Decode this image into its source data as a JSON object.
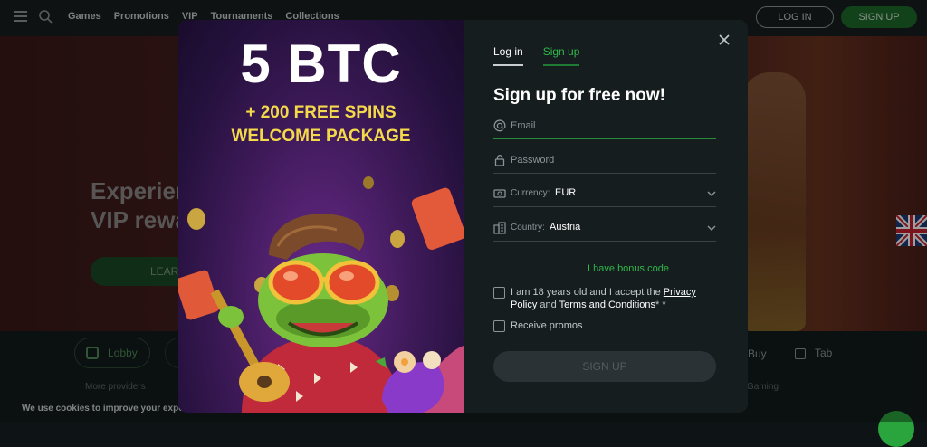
{
  "nav": {
    "links": [
      "Games",
      "Promotions",
      "VIP",
      "Tournaments",
      "Collections"
    ],
    "login_label": "LOG IN",
    "signup_label": "SIGN UP"
  },
  "hero": {
    "title_line1": "Experien",
    "title_line2": "VIP rewa",
    "learn_label": "LEAR"
  },
  "lower": {
    "lobby_label": "Lobby",
    "more_providers": "More providers",
    "buy_label": "Buy",
    "table_label": "Tab",
    "gaming_label": "Gaming",
    "cookie_text": "We use cookies to improve your expe"
  },
  "promo": {
    "headline": "5 BTC",
    "subline1": "+ 200 FREE SPINS",
    "subline2": "WELCOME PACKAGE"
  },
  "form": {
    "tabs": [
      {
        "label": "Log in",
        "active": false
      },
      {
        "label": "Sign up",
        "active": true
      }
    ],
    "title": "Sign up for free now!",
    "email_placeholder": "Email",
    "password_placeholder": "Password",
    "currency_label": "Currency:",
    "currency_value": "EUR",
    "country_label": "Country:",
    "country_value": "Austria",
    "bonus_link": "I have bonus code",
    "terms_prefix": "I am 18 years old and I accept the ",
    "terms_privacy": "Privacy Policy",
    "terms_and": " and ",
    "terms_tc": "Terms and Conditions",
    "terms_suffix": "* *",
    "promos_label": "Receive promos",
    "submit_label": "SIGN UP"
  },
  "colors": {
    "accent_green": "#2fb84a",
    "promo_yellow": "#f4d94a",
    "modal_bg": "#161d1f"
  }
}
